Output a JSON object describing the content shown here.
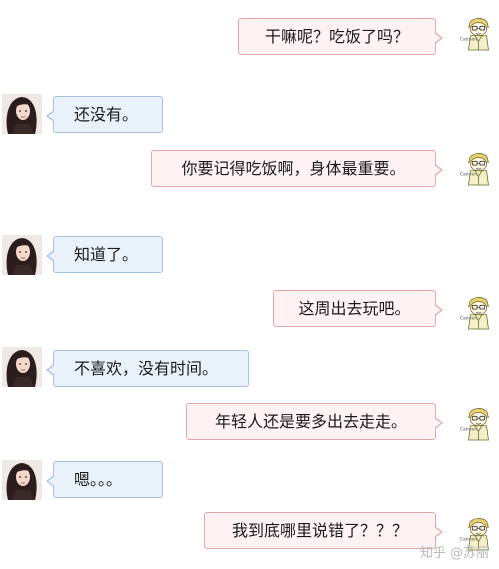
{
  "messages": [
    {
      "side": "right",
      "text": "干嘛呢？吃饭了吗？"
    },
    {
      "side": "left",
      "text": "还没有。"
    },
    {
      "side": "right",
      "text": "你要记得吃饭啊，身体最重要。"
    },
    {
      "side": "left",
      "text": "知道了。"
    },
    {
      "side": "right",
      "text": "这周出去玩吧。"
    },
    {
      "side": "left",
      "text": "不喜欢，没有时间。"
    },
    {
      "side": "right",
      "text": "年轻人还是要多出去走走。"
    },
    {
      "side": "left",
      "text": "嗯。。。"
    },
    {
      "side": "right",
      "text": "我到底哪里说错了？？？"
    }
  ],
  "avatars": {
    "right": "cartoon-boy-avatar-icon",
    "left": "girl-photo-avatar"
  },
  "colors": {
    "right_bubble_bg": "#fff2f2",
    "right_bubble_border": "#e2a8a8",
    "left_bubble_bg": "#e9f1fb",
    "left_bubble_border": "#a7c1e0"
  },
  "watermark": "知乎 @苏丽"
}
